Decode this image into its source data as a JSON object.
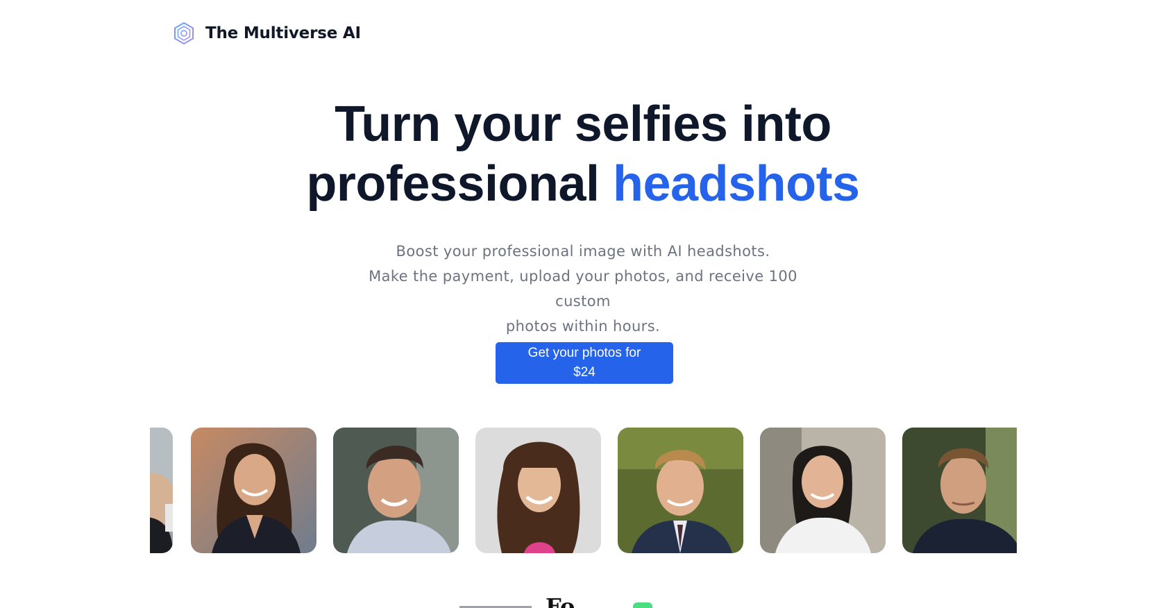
{
  "header": {
    "brand_name": "The Multiverse AI",
    "logo_icon": "hexagon-ring-logo-icon"
  },
  "hero": {
    "title_line1": "Turn your selfies into",
    "title_line2_part1": "professional ",
    "title_line2_highlight": "headshots",
    "subtitle_line1": "Boost your professional image with AI headshots.",
    "subtitle_line2": "Make the payment, upload your photos, and receive 100 custom",
    "subtitle_line3": "photos within hours.",
    "cta_label": "Get your photos for $24"
  },
  "gallery": {
    "photos": [
      {
        "subject": "man-suit"
      },
      {
        "subject": "woman-long-hair-blazer"
      },
      {
        "subject": "young-man-light-shirt"
      },
      {
        "subject": "woman-bangs-pink-top"
      },
      {
        "subject": "man-blonde-suit-tie"
      },
      {
        "subject": "woman-white-blouse"
      },
      {
        "subject": "man-dark-shirt"
      }
    ]
  },
  "press_logos": {
    "logo_2_text": "Fo"
  },
  "colors": {
    "accent": "#2563eb",
    "title": "#0f172a",
    "subtitle": "#6b7280",
    "button_text": "#ffffff"
  }
}
